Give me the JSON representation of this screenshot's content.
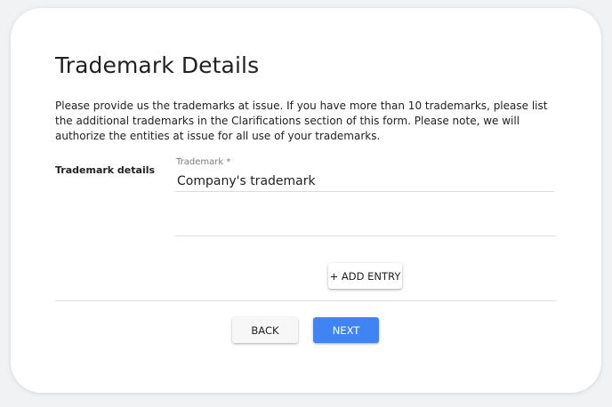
{
  "page": {
    "title": "Trademark Details",
    "description": "Please provide us the trademarks at issue. If you have more than 10 trademarks, please list the additional trademarks in the Clarifications section of this form. Please note, we will authorize the entities at issue for all use of your trademarks."
  },
  "form": {
    "row_label": "Trademark details",
    "trademark_field": {
      "label": "Trademark *",
      "value": "Company's trademark"
    },
    "add_entry_label": "+ ADD ENTRY"
  },
  "footer": {
    "back_label": "BACK",
    "next_label": "NEXT"
  },
  "colors": {
    "primary": "#3f84f2",
    "text": "#212121",
    "muted": "#7b7b7b",
    "divider": "#dedede"
  }
}
